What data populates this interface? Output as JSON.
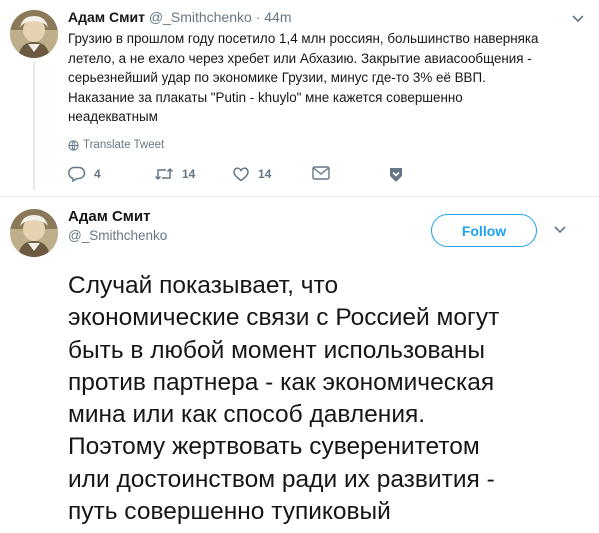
{
  "colors": {
    "accent": "#1da1f2",
    "muted": "#657786",
    "text": "#14171a"
  },
  "reply_tweet": {
    "author_name": "Адам Смит",
    "author_handle": "@_Smithchenko",
    "separator": "·",
    "time": "44m",
    "text_lines": [
      "Грузию в прошлом году посетило 1,4 млн россиян, большинство наверняка",
      "летело, а не ехало через хребет или Абхазию. Закрытие авиасообщения -",
      "серьезнейший удар по экономике Грузии, минус где-то 3% её ВВП.",
      "Наказание за плакаты \"Putin - khuylo\" мне кажется совершенно",
      "неадекватным"
    ],
    "translate_label": "Translate Tweet",
    "actions": {
      "reply_count": "4",
      "retweet_count": "14",
      "like_count": "14"
    },
    "icons": [
      "globe-icon",
      "reply-icon",
      "retweet-icon",
      "heart-icon",
      "envelope-icon",
      "bookmark-icon",
      "chevron-down-icon"
    ]
  },
  "main_tweet": {
    "author_name": "Адам Смит",
    "author_handle": "@_Smithchenko",
    "follow_label": "Follow",
    "text_lines": [
      "Случай показывает, что",
      "экономические связи с Россией могут",
      "быть в любой момент использованы",
      "против партнера - как экономическая",
      "мина или как способ давления.",
      "Поэтому жертвовать суверенитетом",
      "или достоинством ради их развития -",
      "путь совершенно тупиковый"
    ]
  }
}
